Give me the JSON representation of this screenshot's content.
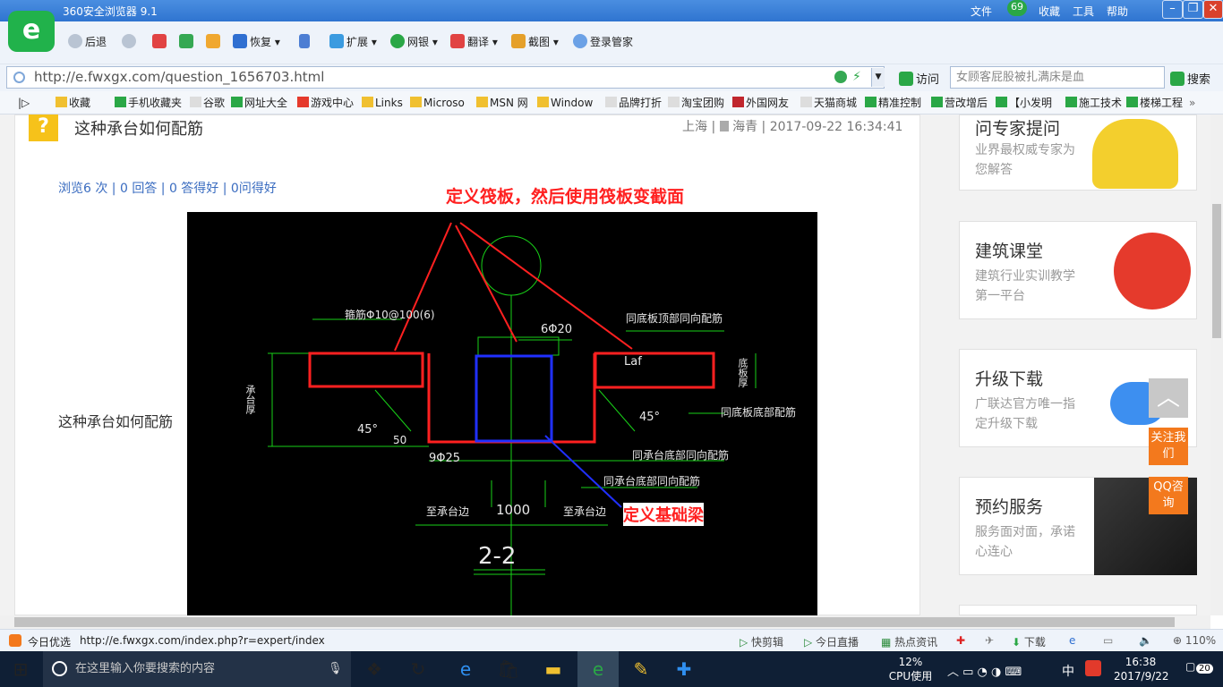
{
  "window": {
    "title": "360安全浏览器 9.1",
    "menu": [
      "文件",
      "收藏",
      "工具",
      "帮助"
    ],
    "badge": "69"
  },
  "toolbar": {
    "back": "后退",
    "restore": "恢复",
    "extend": "扩展",
    "bank": "网银",
    "translate": "翻译",
    "screenshot": "截图",
    "login": "登录管家"
  },
  "address": {
    "url": "http://e.fwxgx.com/question_1656703.html",
    "go": "访问",
    "search_placeholder": "女顾客屁股被扎满床是血",
    "search_btn": "搜索"
  },
  "bookmarks": [
    "收藏",
    "手机收藏夹",
    "谷歌",
    "网址大全",
    "游戏中心",
    "Links",
    "Microso",
    "MSN 网",
    "Window",
    "品牌打折",
    "淘宝团购",
    "外国网友",
    "天猫商城",
    "精准控制",
    "营改增后",
    "【小发明",
    "施工技术",
    "楼梯工程"
  ],
  "question": {
    "title": "这种承台如何配筋",
    "location": "上海",
    "author": "海青",
    "datetime": "2017-09-22 16:34:41",
    "stats": "浏览6 次 | 0 回答 | 0 答得好 | 0问得好",
    "body": "这种承台如何配筋"
  },
  "figure": {
    "annot_top": "定义筏板，然后使用筏板变截面",
    "annot_beam": "定义基础梁",
    "labels": {
      "stirrup": "箍筋Φ10@100(6)",
      "rebar_top": "6Φ20",
      "plate_top": "同底板顶部同向配筋",
      "laf": "Laf",
      "plate_bottom": "同底板底部配筋",
      "cap_bottom1": "同承台底部同向配筋",
      "cap_bottom2": "同承台底部同向配筋",
      "rebar_bot": "9Φ25",
      "angle1": "45°",
      "angle2": "45°",
      "dim50": "50",
      "dim1000": "1000",
      "edge_left": "至承台边",
      "edge_right": "至承台边",
      "section": "2-2",
      "cap_thick": "承台厚",
      "plate_thick": "底板厚"
    }
  },
  "sidebar": [
    {
      "title": "问专家提问",
      "sub": "业界最权威专家为您解答"
    },
    {
      "title": "建筑课堂",
      "sub": "建筑行业实训教学第一平台"
    },
    {
      "title": "升级下载",
      "sub": "广联达官方唯一指定升级下载"
    },
    {
      "title": "预约服务",
      "sub": "服务面对面，承诺心连心"
    }
  ],
  "float": {
    "follow": "关注我们",
    "qq": "QQ咨询"
  },
  "status": {
    "today": "今日优选",
    "url": "http://e.fwxgx.com/index.php?r=expert/index",
    "clip": "快剪辑",
    "live": "今日直播",
    "news": "热点资讯",
    "download": "下载",
    "zoom": "110%"
  },
  "taskbar": {
    "search": "在这里输入你要搜索的内容",
    "cpu": "12%",
    "cpu_label": "CPU使用",
    "ime": "中",
    "time": "16:38",
    "date": "2017/9/22",
    "notif": "20"
  }
}
